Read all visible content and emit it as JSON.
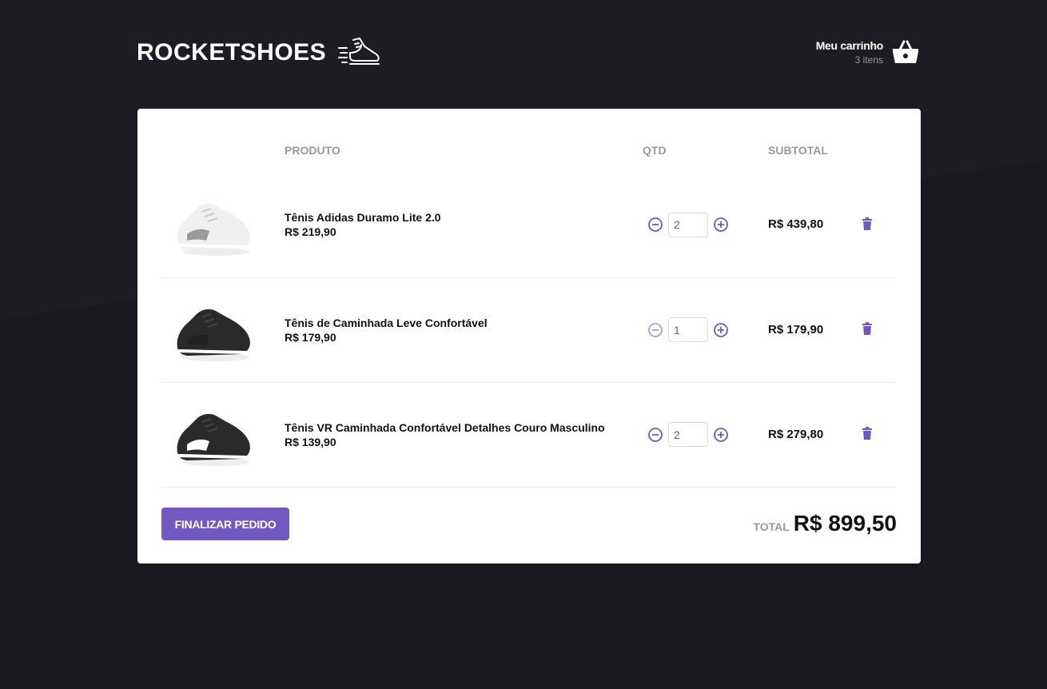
{
  "header": {
    "logo_text": "ROCKETSHOES",
    "cart_title": "Meu carrinho",
    "cart_count": "3 itens"
  },
  "table": {
    "headers": {
      "product": "PRODUTO",
      "qty": "QTD",
      "subtotal": "SUBTOTAL"
    },
    "items": [
      {
        "name": "Tênis Adidas Duramo Lite 2.0",
        "price": "R$ 219,90",
        "qty": "2",
        "subtotal": "R$ 439,80",
        "shoe_color": "#f0f0f0",
        "accent": "#999999",
        "decrement_enabled": true
      },
      {
        "name": "Tênis de Caminhada Leve Confortável",
        "price": "R$ 179,90",
        "qty": "1",
        "subtotal": "R$ 179,90",
        "shoe_color": "#2a2a2a",
        "accent": "#222222",
        "decrement_enabled": false
      },
      {
        "name": "Tênis VR Caminhada Confortável Detalhes Couro Masculino",
        "price": "R$ 139,90",
        "qty": "2",
        "subtotal": "R$ 279,80",
        "shoe_color": "#2a2a2a",
        "accent": "#ffffff",
        "decrement_enabled": true
      }
    ]
  },
  "footer": {
    "checkout_label": "FINALIZAR PEDIDO",
    "total_label": "TOTAL",
    "total_value": "R$ 899,50"
  },
  "colors": {
    "background": "#191920",
    "accent": "#7159c1",
    "disabled": "#a99bd8"
  },
  "icons": {
    "logo": "running-shoe-icon",
    "cart": "shopping-basket-icon",
    "decrement": "minus-circle-icon",
    "increment": "plus-circle-icon",
    "delete": "trash-icon"
  }
}
